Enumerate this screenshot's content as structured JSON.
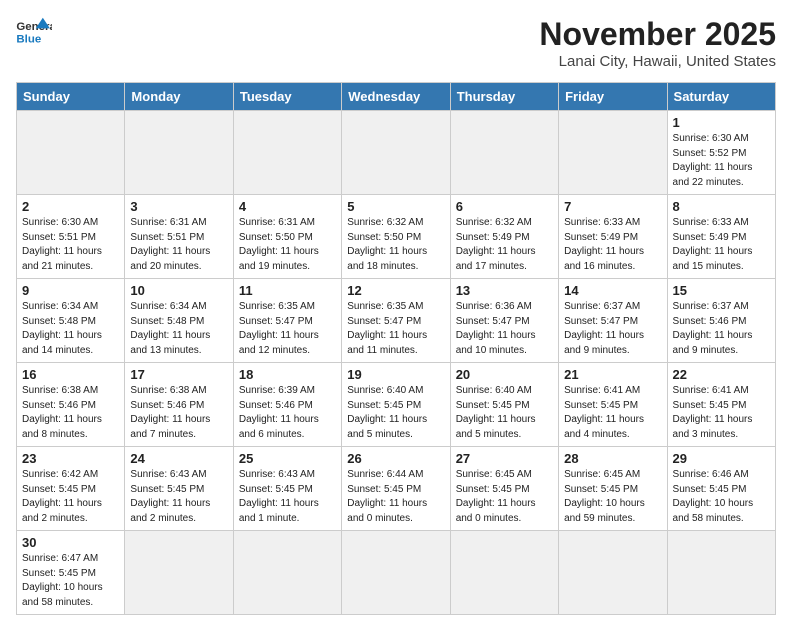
{
  "header": {
    "logo_general": "General",
    "logo_blue": "Blue",
    "month_title": "November 2025",
    "location": "Lanai City, Hawaii, United States"
  },
  "days_of_week": [
    "Sunday",
    "Monday",
    "Tuesday",
    "Wednesday",
    "Thursday",
    "Friday",
    "Saturday"
  ],
  "weeks": [
    [
      {
        "day": "",
        "info": ""
      },
      {
        "day": "",
        "info": ""
      },
      {
        "day": "",
        "info": ""
      },
      {
        "day": "",
        "info": ""
      },
      {
        "day": "",
        "info": ""
      },
      {
        "day": "",
        "info": ""
      },
      {
        "day": "1",
        "info": "Sunrise: 6:30 AM\nSunset: 5:52 PM\nDaylight: 11 hours\nand 22 minutes."
      }
    ],
    [
      {
        "day": "2",
        "info": "Sunrise: 6:30 AM\nSunset: 5:51 PM\nDaylight: 11 hours\nand 21 minutes."
      },
      {
        "day": "3",
        "info": "Sunrise: 6:31 AM\nSunset: 5:51 PM\nDaylight: 11 hours\nand 20 minutes."
      },
      {
        "day": "4",
        "info": "Sunrise: 6:31 AM\nSunset: 5:50 PM\nDaylight: 11 hours\nand 19 minutes."
      },
      {
        "day": "5",
        "info": "Sunrise: 6:32 AM\nSunset: 5:50 PM\nDaylight: 11 hours\nand 18 minutes."
      },
      {
        "day": "6",
        "info": "Sunrise: 6:32 AM\nSunset: 5:49 PM\nDaylight: 11 hours\nand 17 minutes."
      },
      {
        "day": "7",
        "info": "Sunrise: 6:33 AM\nSunset: 5:49 PM\nDaylight: 11 hours\nand 16 minutes."
      },
      {
        "day": "8",
        "info": "Sunrise: 6:33 AM\nSunset: 5:49 PM\nDaylight: 11 hours\nand 15 minutes."
      }
    ],
    [
      {
        "day": "9",
        "info": "Sunrise: 6:34 AM\nSunset: 5:48 PM\nDaylight: 11 hours\nand 14 minutes."
      },
      {
        "day": "10",
        "info": "Sunrise: 6:34 AM\nSunset: 5:48 PM\nDaylight: 11 hours\nand 13 minutes."
      },
      {
        "day": "11",
        "info": "Sunrise: 6:35 AM\nSunset: 5:47 PM\nDaylight: 11 hours\nand 12 minutes."
      },
      {
        "day": "12",
        "info": "Sunrise: 6:35 AM\nSunset: 5:47 PM\nDaylight: 11 hours\nand 11 minutes."
      },
      {
        "day": "13",
        "info": "Sunrise: 6:36 AM\nSunset: 5:47 PM\nDaylight: 11 hours\nand 10 minutes."
      },
      {
        "day": "14",
        "info": "Sunrise: 6:37 AM\nSunset: 5:47 PM\nDaylight: 11 hours\nand 9 minutes."
      },
      {
        "day": "15",
        "info": "Sunrise: 6:37 AM\nSunset: 5:46 PM\nDaylight: 11 hours\nand 9 minutes."
      }
    ],
    [
      {
        "day": "16",
        "info": "Sunrise: 6:38 AM\nSunset: 5:46 PM\nDaylight: 11 hours\nand 8 minutes."
      },
      {
        "day": "17",
        "info": "Sunrise: 6:38 AM\nSunset: 5:46 PM\nDaylight: 11 hours\nand 7 minutes."
      },
      {
        "day": "18",
        "info": "Sunrise: 6:39 AM\nSunset: 5:46 PM\nDaylight: 11 hours\nand 6 minutes."
      },
      {
        "day": "19",
        "info": "Sunrise: 6:40 AM\nSunset: 5:45 PM\nDaylight: 11 hours\nand 5 minutes."
      },
      {
        "day": "20",
        "info": "Sunrise: 6:40 AM\nSunset: 5:45 PM\nDaylight: 11 hours\nand 5 minutes."
      },
      {
        "day": "21",
        "info": "Sunrise: 6:41 AM\nSunset: 5:45 PM\nDaylight: 11 hours\nand 4 minutes."
      },
      {
        "day": "22",
        "info": "Sunrise: 6:41 AM\nSunset: 5:45 PM\nDaylight: 11 hours\nand 3 minutes."
      }
    ],
    [
      {
        "day": "23",
        "info": "Sunrise: 6:42 AM\nSunset: 5:45 PM\nDaylight: 11 hours\nand 2 minutes."
      },
      {
        "day": "24",
        "info": "Sunrise: 6:43 AM\nSunset: 5:45 PM\nDaylight: 11 hours\nand 2 minutes."
      },
      {
        "day": "25",
        "info": "Sunrise: 6:43 AM\nSunset: 5:45 PM\nDaylight: 11 hours\nand 1 minute."
      },
      {
        "day": "26",
        "info": "Sunrise: 6:44 AM\nSunset: 5:45 PM\nDaylight: 11 hours\nand 0 minutes."
      },
      {
        "day": "27",
        "info": "Sunrise: 6:45 AM\nSunset: 5:45 PM\nDaylight: 11 hours\nand 0 minutes."
      },
      {
        "day": "28",
        "info": "Sunrise: 6:45 AM\nSunset: 5:45 PM\nDaylight: 10 hours\nand 59 minutes."
      },
      {
        "day": "29",
        "info": "Sunrise: 6:46 AM\nSunset: 5:45 PM\nDaylight: 10 hours\nand 58 minutes."
      }
    ],
    [
      {
        "day": "30",
        "info": "Sunrise: 6:47 AM\nSunset: 5:45 PM\nDaylight: 10 hours\nand 58 minutes."
      },
      {
        "day": "",
        "info": ""
      },
      {
        "day": "",
        "info": ""
      },
      {
        "day": "",
        "info": ""
      },
      {
        "day": "",
        "info": ""
      },
      {
        "day": "",
        "info": ""
      },
      {
        "day": "",
        "info": ""
      }
    ]
  ]
}
